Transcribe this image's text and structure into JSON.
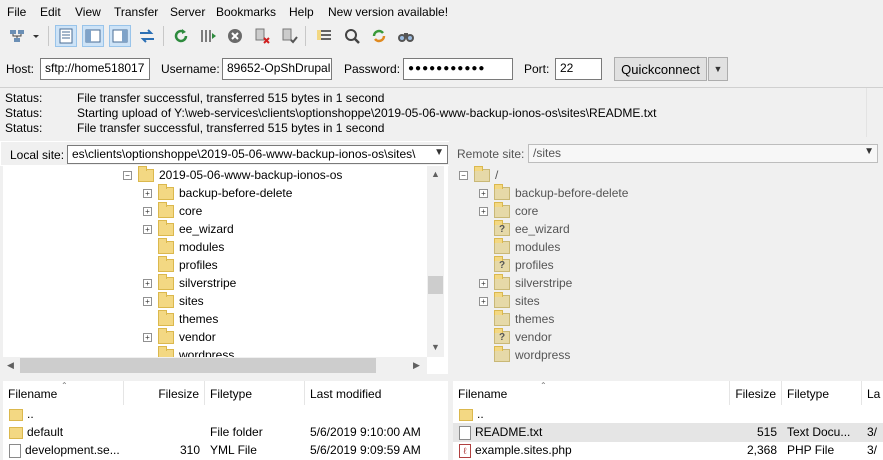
{
  "menu": [
    "File",
    "Edit",
    "View",
    "Transfer",
    "Server",
    "Bookmarks",
    "Help",
    "New version available!"
  ],
  "toolbar_icons": [
    "site-manager-icon",
    "dropdown-arrow-icon",
    "toggle-log-icon",
    "toggle-local-tree-icon",
    "toggle-remote-tree-icon",
    "toggle-queue-icon",
    "refresh-icon",
    "process-queue-icon",
    "cancel-icon",
    "disconnect-icon",
    "reconnect-icon",
    "directory-listing-filters-icon",
    "toggle-comparison-icon",
    "sync-browsing-icon",
    "search-icon"
  ],
  "quickconnect": {
    "host_label": "Host:",
    "host_value": "sftp://home518017",
    "username_label": "Username:",
    "username_value": "89652-OpShDrupal",
    "password_label": "Password:",
    "password_value": "●●●●●●●●●●●",
    "port_label": "Port:",
    "port_value": "22",
    "button": "Quickconnect"
  },
  "log": [
    {
      "key": "Status:",
      "text": "File transfer successful, transferred 515 bytes in 1 second"
    },
    {
      "key": "Status:",
      "text": "Starting upload of Y:\\web-services\\clients\\optionshoppe\\2019-05-06-www-backup-ionos-os\\sites\\README.txt"
    },
    {
      "key": "Status:",
      "text": "File transfer successful, transferred 515 bytes in 1 second"
    }
  ],
  "local": {
    "label": "Local site:",
    "path": "es\\clients\\optionshoppe\\2019-05-06-www-backup-ionos-os\\sites\\",
    "tree_root": "2019-05-06-www-backup-ionos-os",
    "tree": [
      {
        "name": "backup-before-delete",
        "exp": "+"
      },
      {
        "name": "core",
        "exp": "+"
      },
      {
        "name": "ee_wizard",
        "exp": "+"
      },
      {
        "name": "modules",
        "exp": ""
      },
      {
        "name": "profiles",
        "exp": ""
      },
      {
        "name": "silverstripe",
        "exp": "+"
      },
      {
        "name": "sites",
        "exp": "+"
      },
      {
        "name": "themes",
        "exp": ""
      },
      {
        "name": "vendor",
        "exp": "+"
      },
      {
        "name": "wordpress",
        "exp": ""
      }
    ],
    "columns": [
      "Filename",
      "Filesize",
      "Filetype",
      "Last modified"
    ],
    "files": [
      {
        "name": "..",
        "size": "",
        "type": "",
        "modified": ""
      },
      {
        "name": "default",
        "size": "",
        "type": "File folder",
        "modified": "5/6/2019 9:10:00 AM"
      },
      {
        "name": "development.se...",
        "size": "310",
        "type": "YML File",
        "modified": "5/6/2019 9:09:59 AM"
      }
    ]
  },
  "remote": {
    "label": "Remote site:",
    "path": "/sites",
    "tree_root": "/",
    "tree": [
      {
        "name": "backup-before-delete",
        "exp": "+",
        "q": false
      },
      {
        "name": "core",
        "exp": "+",
        "q": false
      },
      {
        "name": "ee_wizard",
        "exp": "",
        "q": true
      },
      {
        "name": "modules",
        "exp": "",
        "q": false
      },
      {
        "name": "profiles",
        "exp": "",
        "q": true
      },
      {
        "name": "silverstripe",
        "exp": "+",
        "q": false
      },
      {
        "name": "sites",
        "exp": "+",
        "q": false
      },
      {
        "name": "themes",
        "exp": "",
        "q": false
      },
      {
        "name": "vendor",
        "exp": "",
        "q": true
      },
      {
        "name": "wordpress",
        "exp": "",
        "q": false
      }
    ],
    "columns": [
      "Filename",
      "Filesize",
      "Filetype",
      "La"
    ],
    "files": [
      {
        "name": "..",
        "size": "",
        "type": "",
        "modified": ""
      },
      {
        "name": "README.txt",
        "size": "515",
        "type": "Text Docu...",
        "modified": "3/"
      },
      {
        "name": "example.sites.php",
        "size": "2,368",
        "type": "PHP File",
        "modified": "3/"
      }
    ]
  }
}
